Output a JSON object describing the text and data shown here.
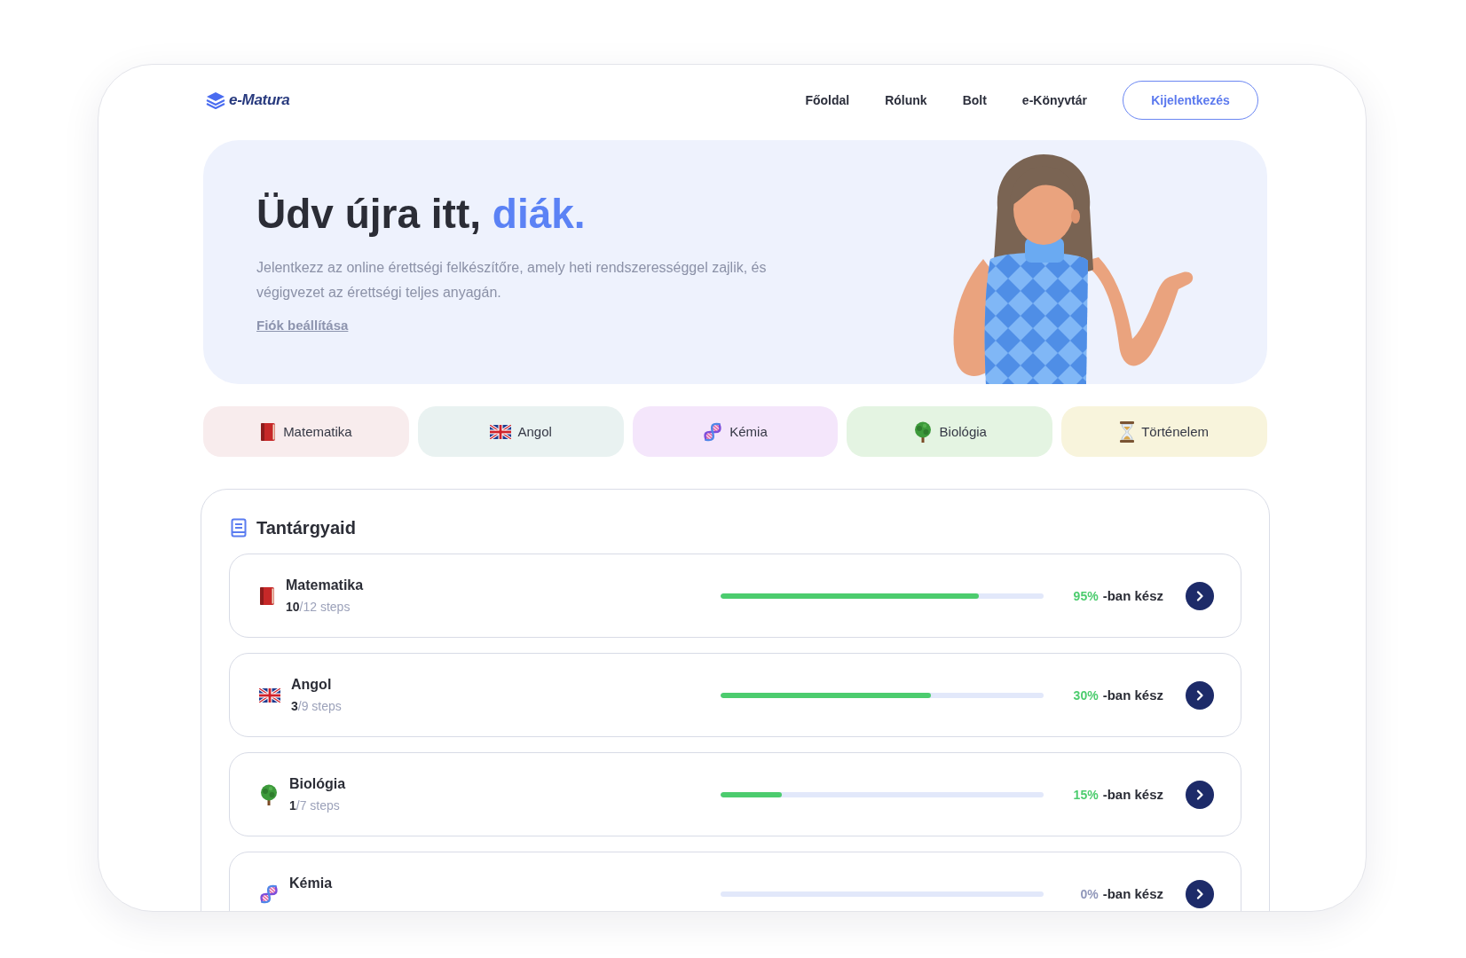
{
  "header": {
    "logo": "e-Matura",
    "nav": [
      "Főoldal",
      "Rólunk",
      "Bolt",
      "e-Könyvtár"
    ],
    "logout_button": "Kijelentkezés"
  },
  "hero": {
    "title": "Üdv újra itt,",
    "title_highlight": "diák.",
    "text": "Jelentkezz az online érettségi felkészítőre, amely heti rendszerességgel zajlik, és végigvezet az érettségi teljes anyagán.",
    "link": "Fiók beállítása"
  },
  "subjects": [
    {
      "label": "Matematika",
      "kind": "math",
      "color": "#f8eced"
    },
    {
      "label": "Angol",
      "kind": "english",
      "color": "#e9f2f1"
    },
    {
      "label": "Kémia",
      "kind": "chemistry",
      "color": "#f4e6fb"
    },
    {
      "label": "Biológia",
      "kind": "biology",
      "color": "#e4f4e2"
    },
    {
      "label": "Történelem",
      "kind": "history",
      "color": "#f8f4dc"
    }
  ],
  "courses": {
    "title": "Tantárgyaid",
    "rows": [
      {
        "name": "Matematika",
        "kind": "math",
        "steps": "**10**/12 steps",
        "level": 0.8,
        "percent": "95%",
        "status": "-ban kész"
      },
      {
        "name": "Angol",
        "kind": "english",
        "steps": "**3**/9 steps",
        "level": 0.65,
        "percent": "30%",
        "status": "-ban kész"
      },
      {
        "name": "Biológia",
        "kind": "biology",
        "steps": "**1**/7 steps",
        "level": 0.19,
        "percent": "15%",
        "status": "-ban kész"
      },
      {
        "name": "Kémia",
        "kind": "chemistry",
        "percent": "0%",
        "status": "-ban kész"
      }
    ]
  }
}
